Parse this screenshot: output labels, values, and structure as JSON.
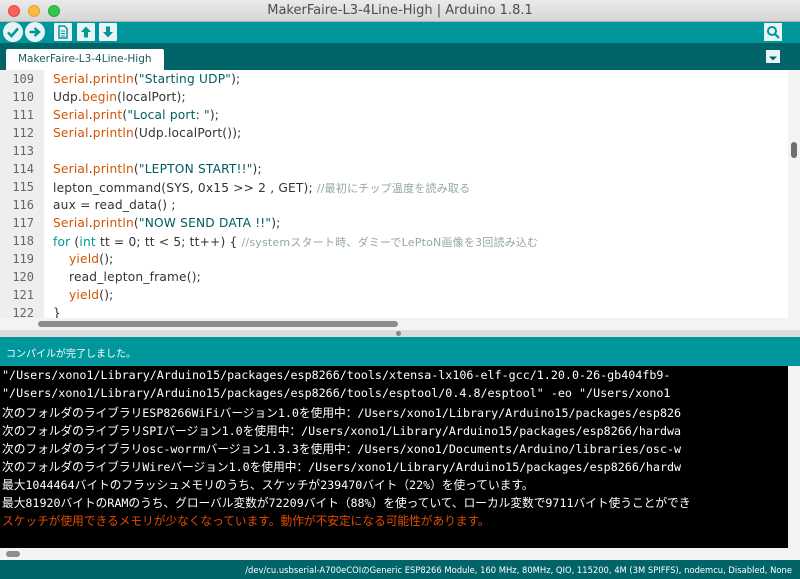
{
  "window": {
    "title": "MakerFaire-L3-4Line-High | Arduino 1.8.1"
  },
  "toolbar": {
    "buttons": [
      "verify-icon",
      "upload-icon",
      "new-icon",
      "open-icon",
      "save-icon",
      "serial-monitor-icon"
    ]
  },
  "tabs": [
    {
      "label": "MakerFaire-L3-4Line-High"
    }
  ],
  "editor": {
    "line_numbers": [
      "109",
      "110",
      "111",
      "112",
      "113",
      "114",
      "115",
      "116",
      "117",
      "118",
      "119",
      "120",
      "121",
      "122"
    ],
    "lines": [
      "Serial.println(\"Starting UDP\");",
      "Udp.begin(localPort);",
      "Serial.print(\"Local port: \");",
      "Serial.println(Udp.localPort());",
      "",
      "Serial.println(\"LEPTON START!!\");",
      "lepton_command(SYS, 0x15 >> 2 , GET); //最初にチップ温度を読み取る",
      "aux = read_data() ;",
      "Serial.println(\"NOW SEND DATA !!\");",
      "for (int tt = 0; tt < 5; tt++) { //systemスタート時、ダミーでLePtoN画像を3回読み込む",
      "  yield();",
      "  read_lepton_frame();",
      "  yield();",
      "}"
    ],
    "tokens": {
      "serial": "Serial",
      "println": "println",
      "print": "print",
      "udp_begin_pre": "Udp.",
      "begin": "begin",
      "local_port_arg": "(localPort);",
      "str_starting": "\"Starting UDP\"",
      "str_local": "\"Local port: \"",
      "str_lepton": "\"LEPTON START!!\"",
      "str_now": "\"NOW SEND DATA !!\"",
      "udp_localport": "(Udp.localPort());",
      "lepton_cmd": "lepton_command(SYS, 0x15 >> 2 , GET); ",
      "comment_temp": "//最初にチップ温度を読み取る",
      "aux_line": "aux = read_data() ;",
      "for_kw": "for",
      "for_open": " (",
      "int_kw": "int",
      "for_rest": " tt = 0; tt < 5; tt++) { ",
      "comment_system": "//systemスタート時、ダミーでLePtoN画像を3回読み込む",
      "yield": "yield",
      "call_end": "();",
      "semi_end": ");",
      "dot": ".",
      "open_paren": "(",
      "read_frame": "read_lepton_frame();",
      "close_brace": "}"
    }
  },
  "status": {
    "message": "コンパイルが完了しました。"
  },
  "console": {
    "lines": [
      "\"/Users/xono1/Library/Arduino15/packages/esp8266/tools/xtensa-lx106-elf-gcc/1.20.0-26-gb404fb9-",
      "\"/Users/xono1/Library/Arduino15/packages/esp8266/tools/esptool/0.4.8/esptool\" -eo \"/Users/xono1",
      "次のフォルダのライブラリESP8266WiFiバージョン1.0を使用中：/Users/xono1/Library/Arduino15/packages/esp826",
      "次のフォルダのライブラリSPIバージョン1.0を使用中：/Users/xono1/Library/Arduino15/packages/esp8266/hardwa",
      "次のフォルダのライブラリosc-worrmバージョン1.3.3を使用中：/Users/xono1/Documents/Arduino/libraries/osc-w",
      "次のフォルダのライブラリWireバージョン1.0を使用中：/Users/xono1/Library/Arduino15/packages/esp8266/hardw",
      "最大1044464バイトのフラッシュメモリのうち、スケッチが239470バイト（22%）を使っています。",
      "最大81920バイトのRAMのうち、グローバル変数が72209バイト（88%）を使っていて、ローカル変数で9711バイト使うことができ",
      "スケッチが使用できるメモリが少なくなっています。動作が不安定になる可能性があります。"
    ],
    "error_line_index": 8
  },
  "footer": {
    "board_info": "/dev/cu.usbserial-A700eCOIのGeneric ESP8266 Module, 160 MHz, 80MHz, QIO, 115200, 4M (3M SPIFFS), nodemcu, Disabled, None"
  },
  "colors": {
    "toolbar": "#00979c",
    "tabbar": "#006468",
    "keyword_orange": "#d35400",
    "keyword_teal": "#00979c",
    "error_text": "#e34c00"
  }
}
